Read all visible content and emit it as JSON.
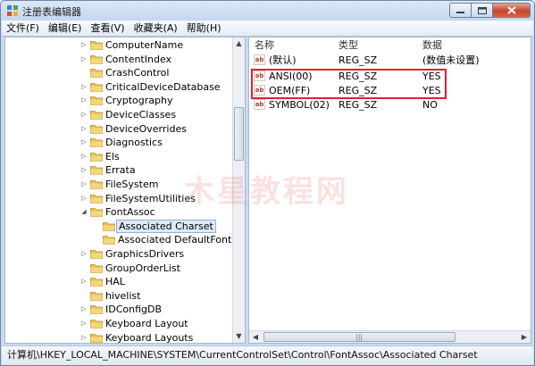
{
  "window": {
    "title": "注册表编辑器",
    "icon": "registry-icon"
  },
  "menu": [
    {
      "label": "文件(F)"
    },
    {
      "label": "编辑(E)"
    },
    {
      "label": "查看(V)"
    },
    {
      "label": "收藏夹(A)"
    },
    {
      "label": "帮助(H)"
    }
  ],
  "tree": {
    "items": [
      {
        "label": "ComputerName",
        "expandable": true,
        "level": 0
      },
      {
        "label": "ContentIndex",
        "expandable": true,
        "level": 0
      },
      {
        "label": "CrashControl",
        "expandable": false,
        "level": 0
      },
      {
        "label": "CriticalDeviceDatabase",
        "expandable": true,
        "level": 0
      },
      {
        "label": "Cryptography",
        "expandable": true,
        "level": 0
      },
      {
        "label": "DeviceClasses",
        "expandable": true,
        "level": 0
      },
      {
        "label": "DeviceOverrides",
        "expandable": true,
        "level": 0
      },
      {
        "label": "Diagnostics",
        "expandable": true,
        "level": 0
      },
      {
        "label": "Els",
        "expandable": true,
        "level": 0
      },
      {
        "label": "Errata",
        "expandable": true,
        "level": 0
      },
      {
        "label": "FileSystem",
        "expandable": true,
        "level": 0
      },
      {
        "label": "FileSystemUtilities",
        "expandable": true,
        "level": 0
      },
      {
        "label": "FontAssoc",
        "expandable": true,
        "expanded": true,
        "level": 0
      },
      {
        "label": "Associated Charset",
        "expandable": false,
        "level": 1,
        "selected": true
      },
      {
        "label": "Associated DefaultFonts",
        "expandable": false,
        "level": 1
      },
      {
        "label": "GraphicsDrivers",
        "expandable": true,
        "level": 0
      },
      {
        "label": "GroupOrderList",
        "expandable": false,
        "level": 0
      },
      {
        "label": "HAL",
        "expandable": true,
        "level": 0
      },
      {
        "label": "hivelist",
        "expandable": false,
        "level": 0
      },
      {
        "label": "IDConfigDB",
        "expandable": true,
        "level": 0
      },
      {
        "label": "Keyboard Layout",
        "expandable": true,
        "level": 0
      },
      {
        "label": "Keyboard Layouts",
        "expandable": true,
        "level": 0
      }
    ]
  },
  "values": {
    "columns": {
      "name": "名称",
      "type": "类型",
      "data": "数据"
    },
    "rows": [
      {
        "name": "(默认)",
        "type": "REG_SZ",
        "data": "(数值未设置)"
      },
      {
        "name": "ANSI(00)",
        "type": "REG_SZ",
        "data": "YES"
      },
      {
        "name": "OEM(FF)",
        "type": "REG_SZ",
        "data": "YES"
      },
      {
        "name": "SYMBOL(02)",
        "type": "REG_SZ",
        "data": "NO"
      }
    ]
  },
  "status": {
    "path": "计算机\\HKEY_LOCAL_MACHINE\\SYSTEM\\CurrentControlSet\\Control\\FontAssoc\\Associated Charset"
  },
  "watermark": "木星教程网",
  "colors": {
    "highlight_box": "#e0202a",
    "selection": "#dfeaf8",
    "folder": "#e8c35a"
  }
}
